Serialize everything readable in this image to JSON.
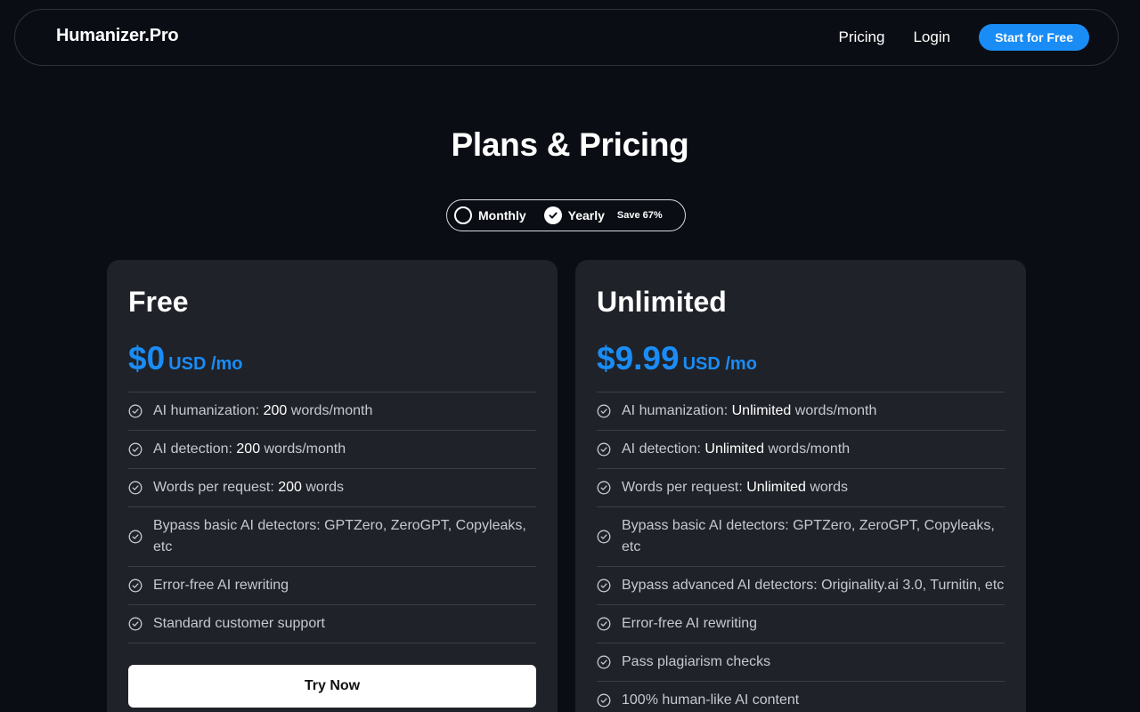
{
  "nav": {
    "logo": "Humanizer.Pro",
    "links": [
      "Pricing",
      "Login"
    ],
    "cta": "Start for Free"
  },
  "page_title": "Plans & Pricing",
  "billing_toggle": {
    "monthly": "Monthly",
    "yearly": "Yearly",
    "save_badge": "Save 67%",
    "selected": "Yearly"
  },
  "plans": [
    {
      "name": "Free",
      "price": "$0",
      "unit": "USD /mo",
      "features": [
        {
          "pre": "AI humanization: ",
          "hl": "200",
          "post": " words/month"
        },
        {
          "pre": "AI detection: ",
          "hl": "200",
          "post": " words/month"
        },
        {
          "pre": "Words per request: ",
          "hl": "200",
          "post": " words"
        },
        {
          "pre": "Bypass basic AI detectors: GPTZero, ZeroGPT, Copyleaks, etc",
          "hl": "",
          "post": ""
        },
        {
          "pre": "Error-free AI rewriting",
          "hl": "",
          "post": ""
        },
        {
          "pre": "Standard customer support",
          "hl": "",
          "post": ""
        }
      ],
      "button": "Try Now"
    },
    {
      "name": "Unlimited",
      "price": "$9.99",
      "unit": "USD /mo",
      "features": [
        {
          "pre": "AI humanization: ",
          "hl": "Unlimited",
          "post": " words/month"
        },
        {
          "pre": "AI detection: ",
          "hl": "Unlimited",
          "post": " words/month"
        },
        {
          "pre": "Words per request: ",
          "hl": "Unlimited",
          "post": " words"
        },
        {
          "pre": "Bypass basic AI detectors: GPTZero, ZeroGPT, Copyleaks, etc",
          "hl": "",
          "post": ""
        },
        {
          "pre": "Bypass advanced AI detectors: Originality.ai 3.0, Turnitin, etc",
          "hl": "",
          "post": ""
        },
        {
          "pre": "Error-free AI rewriting",
          "hl": "",
          "post": ""
        },
        {
          "pre": "Pass plagiarism checks",
          "hl": "",
          "post": ""
        },
        {
          "pre": "100% human-like AI content",
          "hl": "",
          "post": ""
        }
      ]
    }
  ],
  "colors": {
    "accent": "#1a8cf5",
    "background": "#0a0d14",
    "card": "#1f2228"
  },
  "icons": {
    "feature_check": "check-circle-icon",
    "toggle_selected": "check-circle-filled-icon",
    "toggle_unselected": "radio-empty-icon"
  }
}
